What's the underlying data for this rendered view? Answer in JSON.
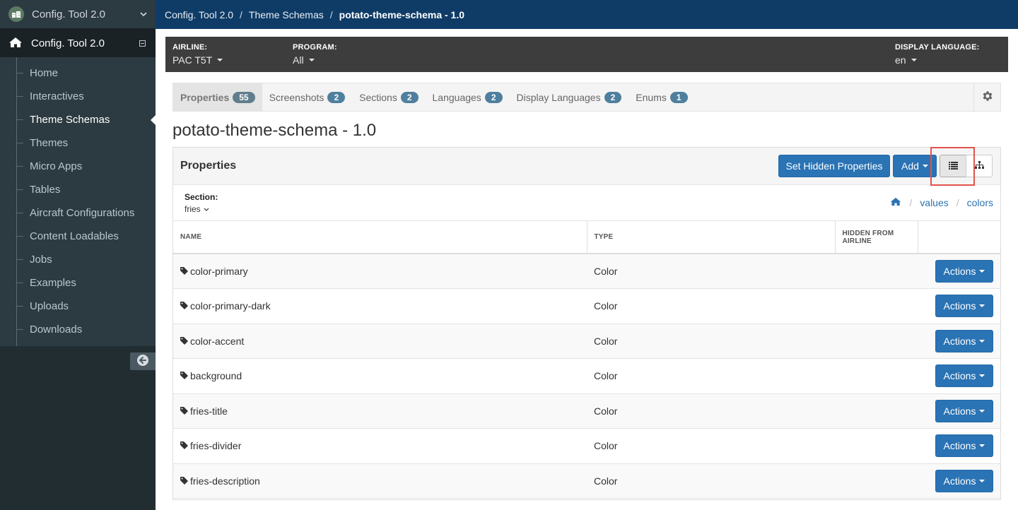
{
  "app": {
    "switcher_label": "Config. Tool 2.0",
    "header_label": "Config. Tool 2.0"
  },
  "sidebar": {
    "items": [
      {
        "label": "Home"
      },
      {
        "label": "Interactives"
      },
      {
        "label": "Theme Schemas",
        "active": true
      },
      {
        "label": "Themes"
      },
      {
        "label": "Micro Apps"
      },
      {
        "label": "Tables"
      },
      {
        "label": "Aircraft Configurations"
      },
      {
        "label": "Content Loadables"
      },
      {
        "label": "Jobs"
      },
      {
        "label": "Examples"
      },
      {
        "label": "Uploads"
      },
      {
        "label": "Downloads"
      }
    ]
  },
  "breadcrumb": {
    "items": [
      "Config. Tool 2.0",
      "Theme Schemas",
      "potato-theme-schema - 1.0"
    ],
    "separator": "/"
  },
  "context": {
    "airline_label": "AIRLINE:",
    "airline_value": "PAC T5T",
    "program_label": "PROGRAM:",
    "program_value": "All",
    "language_label": "DISPLAY LANGUAGE:",
    "language_value": "en"
  },
  "tabs": [
    {
      "label": "Properties",
      "count": "55"
    },
    {
      "label": "Screenshots",
      "count": "2"
    },
    {
      "label": "Sections",
      "count": "2"
    },
    {
      "label": "Languages",
      "count": "2"
    },
    {
      "label": "Display Languages",
      "count": "2"
    },
    {
      "label": "Enums",
      "count": "1"
    }
  ],
  "page_title": "potato-theme-schema - 1.0",
  "panel": {
    "title": "Properties",
    "set_hidden_label": "Set Hidden Properties",
    "add_label": "Add"
  },
  "section": {
    "label": "Section:",
    "value": "fries",
    "path": [
      "values",
      "colors"
    ],
    "path_separator": "/"
  },
  "table": {
    "headers": {
      "name": "NAME",
      "type": "TYPE",
      "hidden_line1": "HIDDEN FROM",
      "hidden_line2": "AIRLINE"
    },
    "actions_label": "Actions",
    "rows": [
      {
        "name": "color-primary",
        "type": "Color"
      },
      {
        "name": "color-primary-dark",
        "type": "Color"
      },
      {
        "name": "color-accent",
        "type": "Color"
      },
      {
        "name": "background",
        "type": "Color"
      },
      {
        "name": "fries-title",
        "type": "Color"
      },
      {
        "name": "fries-divider",
        "type": "Color"
      },
      {
        "name": "fries-description",
        "type": "Color"
      }
    ]
  },
  "colors": {
    "topbar": "#0f3c67",
    "sidebar": "#222d32",
    "primary_button": "#2a73b4",
    "badge": "#4f7f9e",
    "highlight": "#e0534f"
  },
  "icons": {
    "app_logo": "app-logo-icon",
    "home": "home-icon",
    "collapse": "minus-square-icon",
    "back": "arrow-circle-left-icon",
    "gear": "gear-icon",
    "list": "list-icon",
    "tree": "sitemap-icon",
    "tag": "tag-icon"
  }
}
